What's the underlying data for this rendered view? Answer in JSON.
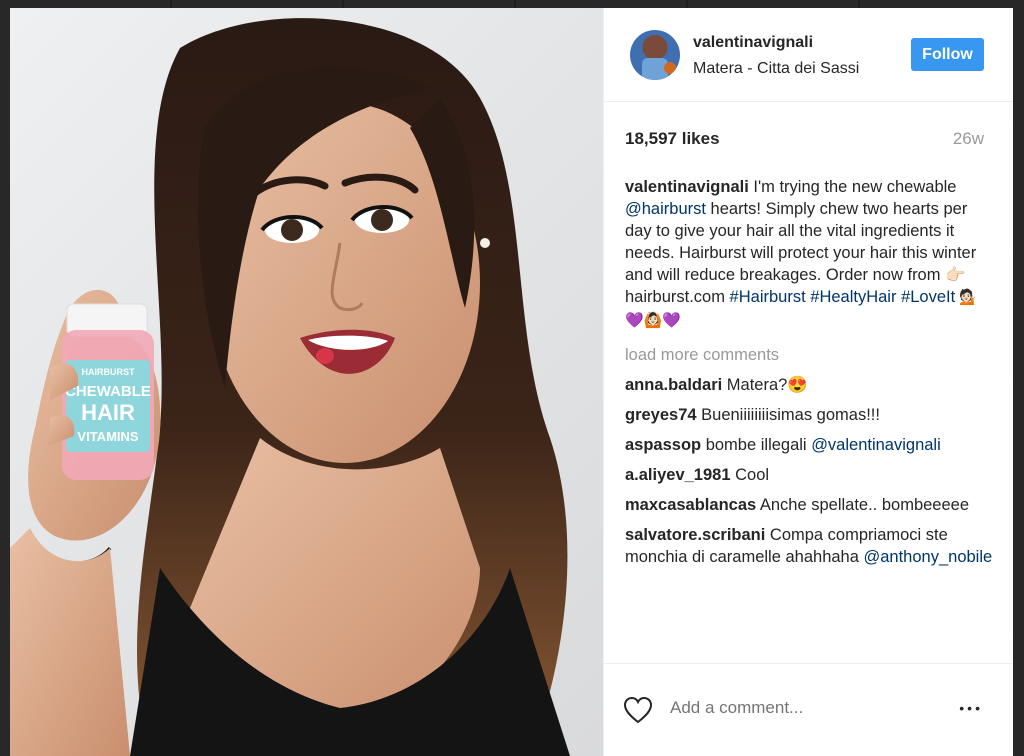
{
  "post": {
    "username": "valentinavignali",
    "location": "Matera - Citta dei Sassi",
    "follow_label": "Follow",
    "likes": "18,597 likes",
    "age": "26w",
    "caption": {
      "user": "valentinavignali",
      "part1": " I'm trying the new chewable ",
      "mention": "@hairburst",
      "part2": " hearts! Simply chew two hearts per day to give your hair all the vital ingredients it needs. Hairburst will protect your hair this winter and will reduce breakages. Order now from 👉🏻 hairburst.com ",
      "tag1": "#Hairburst",
      "tag2": "#HealtyHair",
      "tag3": "#LoveIt",
      "emojis": " 💁🏻💜🙆🏻💜"
    },
    "load_more": "load more comments",
    "comments": [
      {
        "user": "anna.baldari",
        "text": " Matera?😍"
      },
      {
        "user": "greyes74",
        "text": " Bueniiiiiiiisimas gomas!!!"
      },
      {
        "user": "aspassop",
        "text": " bombe illegali ",
        "mention": "@valentinavignali"
      },
      {
        "user": "a.aliyev_1981",
        "text": " Cool"
      },
      {
        "user": "maxcasablancas",
        "text": " Anche spellate.. bombeeeee"
      },
      {
        "user": "salvatore.scribani",
        "text": " Compa compriamoci ste monchia di caramelle ahahhaha ",
        "mention": "@anthony_nobile"
      }
    ],
    "add_comment_placeholder": "Add a comment...",
    "more_label": "•••"
  },
  "photo": {
    "bottle_brand": "HAIRBURST",
    "bottle_line1": "CHEWABLE",
    "bottle_line2": "HAIR",
    "bottle_line3": "VITAMINS"
  },
  "colors": {
    "follow": "#3897f0",
    "link": "#003569",
    "muted": "#999999"
  },
  "icons": [
    "heart-icon",
    "more-options-icon"
  ]
}
